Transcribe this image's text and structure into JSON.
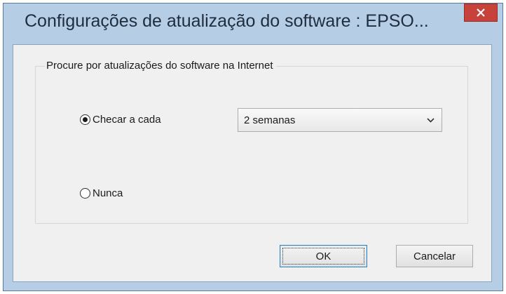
{
  "window": {
    "title": "Configurações de atualização do software : EPSO...",
    "close_icon": "close-icon"
  },
  "group": {
    "legend": "Procure por atualizações do software na Internet"
  },
  "options": {
    "check_every_label": "Checar a cada",
    "check_every_selected": true,
    "never_label": "Nunca",
    "never_selected": false
  },
  "interval_select": {
    "value": "2 semanas",
    "icon": "chevron-down-icon"
  },
  "buttons": {
    "ok_label": "OK",
    "cancel_label": "Cancelar"
  },
  "colors": {
    "frame": "#b6cde6",
    "close_button": "#c7423a",
    "client_background": "#f0f0f0"
  }
}
